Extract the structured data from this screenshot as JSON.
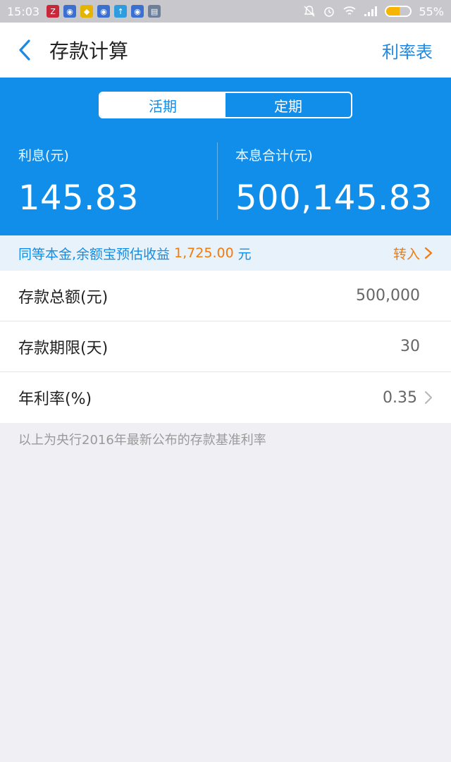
{
  "status_bar": {
    "time": "15:03",
    "battery_percent_text": "55%",
    "battery_level": 0.55,
    "icons": [
      "zhihu-icon",
      "shield-app-icon",
      "app-icon",
      "shield-app-icon",
      "upload-icon",
      "shield-app-icon",
      "message-icon"
    ]
  },
  "nav": {
    "title": "存款计算",
    "right_link": "利率表"
  },
  "tabs": {
    "items": [
      {
        "label": "活期",
        "active": true
      },
      {
        "label": "定期",
        "active": false
      }
    ]
  },
  "stats": {
    "interest_label": "利息(元)",
    "interest_value": "145.83",
    "total_label": "本息合计(元)",
    "total_value": "500,145.83"
  },
  "promo": {
    "text": "同等本金,余额宝预估收益",
    "amount": "1,725.00",
    "unit": "元",
    "action": "转入"
  },
  "form": {
    "rows": [
      {
        "label": "存款总额(元)",
        "value": "500,000"
      },
      {
        "label": "存款期限(天)",
        "value": "30"
      },
      {
        "label": "年利率(%)",
        "value": "0.35"
      }
    ]
  },
  "footnote": "以上为央行2016年最新公布的存款基准利率",
  "colors": {
    "primary_blue": "#108ee9",
    "orange": "#f47a0a",
    "background": "#efeff4"
  }
}
